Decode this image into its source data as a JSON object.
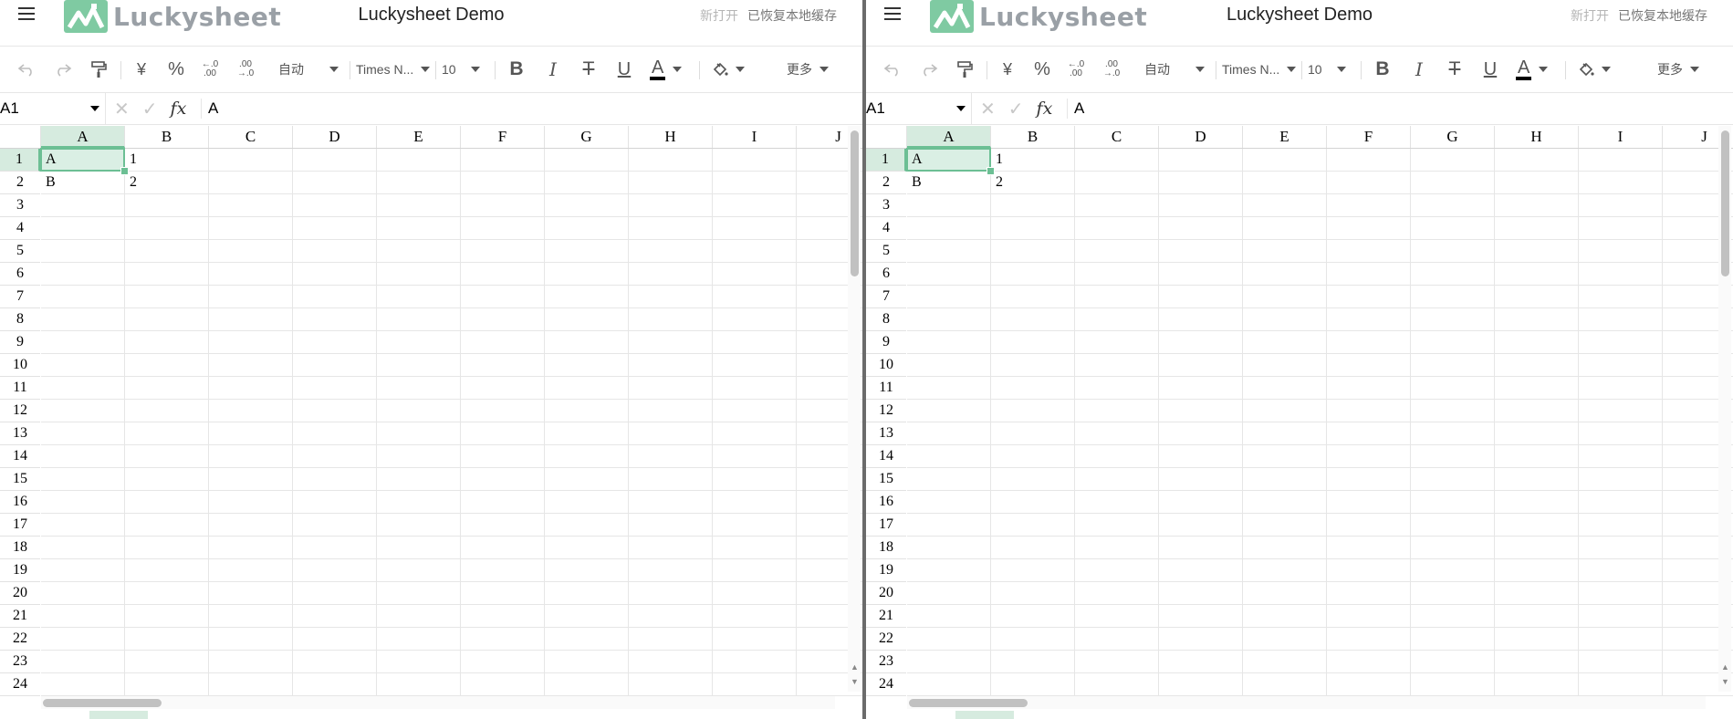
{
  "header": {
    "brand": "Luckysheet",
    "title": "Luckysheet Demo",
    "status_new": "新打开",
    "status_restored": "已恢复本地缓存"
  },
  "toolbar": {
    "undo": "↶",
    "redo": "↷",
    "format_painter": "format-painter-icon",
    "currency": "¥",
    "percent": "%",
    "dec_decrease": "←.0\n.00",
    "dec_increase": ".00\n→.0",
    "number_format": "自动",
    "font_family": "Times N...",
    "font_size": "10",
    "bold": "B",
    "italic": "I",
    "strike": "T",
    "underline": "U",
    "font_color": "A",
    "font_color_value": "#000000",
    "more": "更多"
  },
  "formula_bar": {
    "cell_ref": "A1",
    "cancel": "✕",
    "confirm": "✓",
    "fx": "fx",
    "value": "A"
  },
  "grid": {
    "columns": [
      "A",
      "B",
      "C",
      "D",
      "E",
      "F",
      "G",
      "H",
      "I",
      "J"
    ],
    "rows": [
      "1",
      "2",
      "3",
      "4",
      "5",
      "6",
      "7",
      "8",
      "9",
      "10",
      "11",
      "12",
      "13",
      "14",
      "15",
      "16",
      "17",
      "18",
      "19",
      "20",
      "21",
      "22",
      "23",
      "24"
    ],
    "cells": {
      "A1": "A",
      "B1": "1",
      "A2": "B",
      "B2": "2"
    },
    "selected": "A1"
  },
  "colors": {
    "accent": "#6cbf94",
    "selection_fill": "#d6ebdf",
    "logo": "#7fcaa2"
  }
}
